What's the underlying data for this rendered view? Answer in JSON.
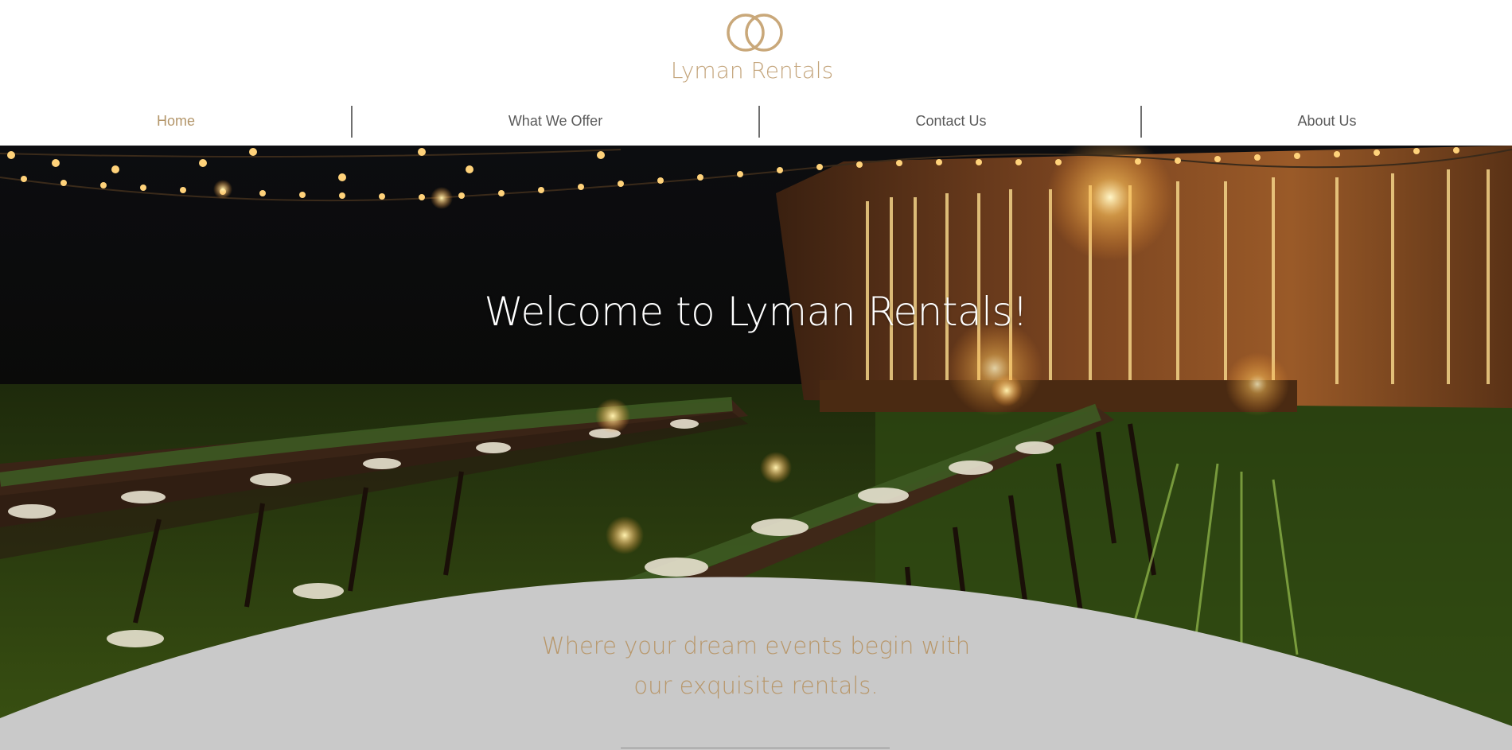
{
  "brand": {
    "name": "Lyman Rentals",
    "logo_icon": "wedding-rings-icon",
    "accent_color": "#c4a57c"
  },
  "nav": {
    "items": [
      {
        "label": "Home",
        "active": true
      },
      {
        "label": "What We Offer",
        "active": false
      },
      {
        "label": "Contact Us",
        "active": false
      },
      {
        "label": "About Us",
        "active": false
      }
    ]
  },
  "hero": {
    "title": "Welcome to Lyman Rentals!",
    "tagline_line1": "Where your dream events begin with",
    "tagline_line2": "our exquisite rentals."
  }
}
